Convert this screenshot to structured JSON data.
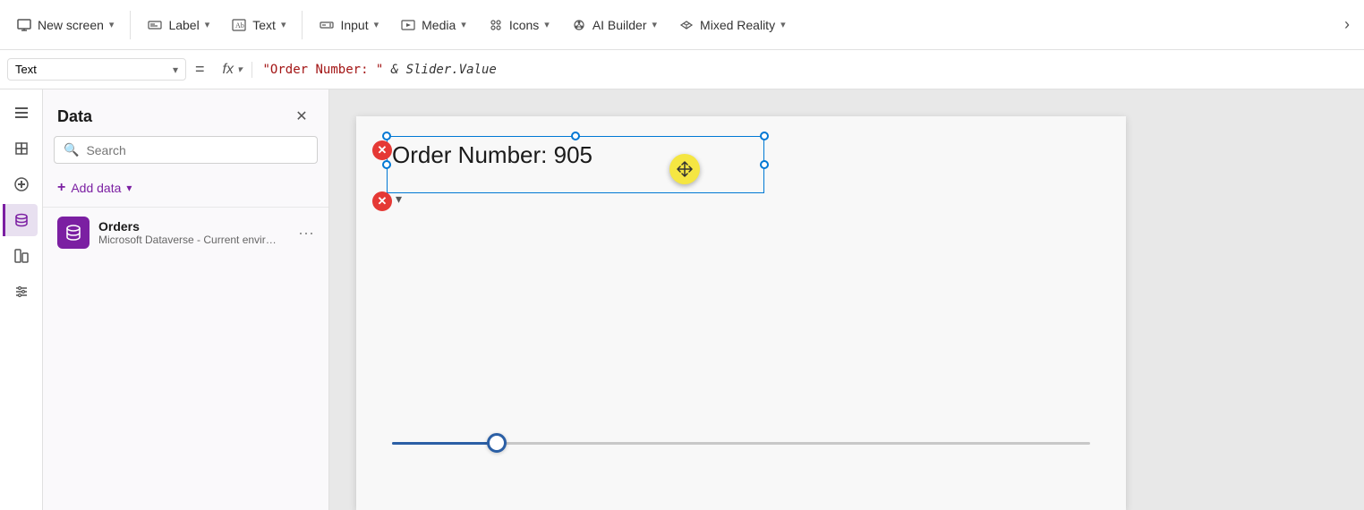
{
  "toolbar": {
    "new_screen_label": "New screen",
    "label_label": "Label",
    "text_label": "Text",
    "input_label": "Input",
    "media_label": "Media",
    "icons_label": "Icons",
    "ai_builder_label": "AI Builder",
    "mixed_reality_label": "Mixed Reality"
  },
  "formula_bar": {
    "property": "Text",
    "fx_label": "fx",
    "formula": "\"Order Number: \" & Slider.Value",
    "formula_string_part": "\"Order Number: \"",
    "formula_code_part": " & Slider.Value"
  },
  "data_panel": {
    "title": "Data",
    "search_placeholder": "Search",
    "add_data_label": "Add data",
    "data_sources": [
      {
        "name": "Orders",
        "description": "Microsoft Dataverse - Current environ...",
        "icon": "database"
      }
    ]
  },
  "canvas": {
    "text_element_value": "Order Number: 905",
    "slider_value": 15
  },
  "sidebar_icons": [
    {
      "name": "menu-icon",
      "symbol": "≡"
    },
    {
      "name": "layers-icon",
      "symbol": "⊞"
    },
    {
      "name": "add-icon",
      "symbol": "+"
    },
    {
      "name": "database-active-icon",
      "symbol": "🗄"
    },
    {
      "name": "chart-icon",
      "symbol": "📊"
    },
    {
      "name": "settings-icon",
      "symbol": "⚙"
    }
  ]
}
